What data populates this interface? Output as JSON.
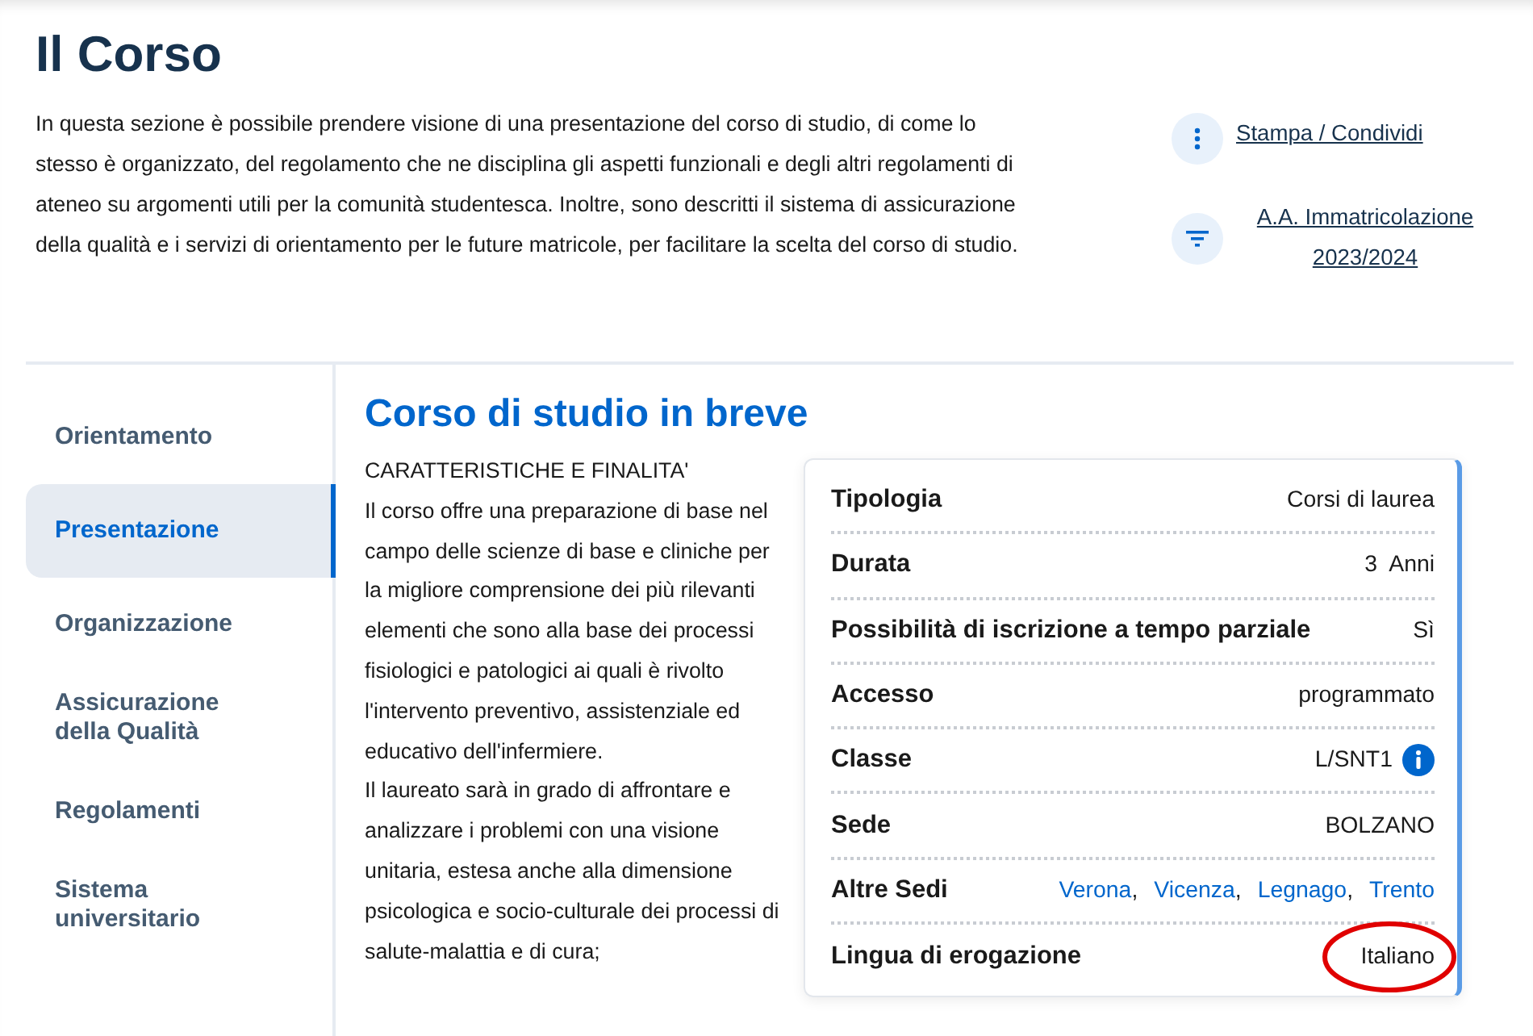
{
  "page_title": "Il Corso",
  "intro": "In questa sezione è possibile prendere visione di una presentazione del corso di studio, di come lo stesso è organizzato, del regolamento che ne disciplina gli aspetti funzionali e degli altri regolamenti di ateneo su argomenti utili per la comunità studentesca. Inoltre, sono descritti il sistema di assicurazione della qualità e i servizi di orientamento per le future matricole, per facilitare la scelta del corso di studio.",
  "actions": [
    {
      "kind": "more",
      "label": "Stampa / Condividi"
    },
    {
      "kind": "filter",
      "label": "A.A. Immatricolazione 2023/2024"
    }
  ],
  "sidebar": {
    "items": [
      {
        "label": "Orientamento",
        "selected": false
      },
      {
        "label": "Presentazione",
        "selected": true
      },
      {
        "label": "Organizzazione",
        "selected": false
      },
      {
        "label": "Assicurazione della Qualità",
        "selected": false
      },
      {
        "label": "Regolamenti",
        "selected": false
      },
      {
        "label": "Sistema universitario",
        "selected": false
      }
    ]
  },
  "section_title": "Corso di studio in breve",
  "body": [
    "CARATTERISTICHE E FINALITA'",
    "Il corso offre una preparazione di base nel campo delle scienze di base e cliniche per la migliore comprensione dei più rilevanti elementi che sono alla base dei processi fisiologici e patologici ai quali è rivolto l'intervento preventivo, assistenziale ed educativo dell'infermiere.",
    "Il laureato sarà in grado di affrontare e analizzare i problemi con una visione unitaria, estesa anche alla dimensione psicologica e socio-culturale dei processi di salute-malattia e di cura;"
  ],
  "info_card": {
    "rows": [
      {
        "kind": "text",
        "label": "Tipologia",
        "value": "Corsi di laurea",
        "circled": false
      },
      {
        "kind": "text",
        "label": "Durata",
        "value": "3  Anni",
        "circled": false
      },
      {
        "kind": "text",
        "label": "Possibilità di iscrizione a tempo parziale",
        "value": "Sì",
        "circled": false
      },
      {
        "kind": "text",
        "label": "Accesso",
        "value": "programmato",
        "circled": false
      },
      {
        "kind": "info",
        "label": "Classe",
        "value": "L/SNT1",
        "circled": false
      },
      {
        "kind": "text",
        "label": "Sede",
        "value": "BOLZANO",
        "circled": false
      },
      {
        "kind": "links",
        "label": "Altre Sedi",
        "links": [
          {
            "text": "Verona",
            "sep": ","
          },
          {
            "text": "Vicenza",
            "sep": ","
          },
          {
            "text": "Legnago",
            "sep": ","
          },
          {
            "text": "Trento"
          }
        ],
        "circled": false
      },
      {
        "kind": "text",
        "label": "Lingua di erogazione",
        "value": "Italiano",
        "circled": true
      }
    ]
  }
}
